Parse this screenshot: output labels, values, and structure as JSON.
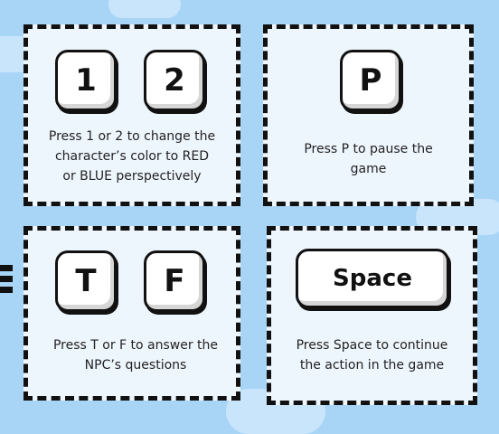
{
  "panels": {
    "color": {
      "keys": [
        "1",
        "2"
      ],
      "lines": [
        "Press 1 or 2 to change the",
        "character’s color to RED",
        "or BLUE perspectively"
      ]
    },
    "pause": {
      "key": "P",
      "lines": [
        "Press P to pause the",
        "game"
      ]
    },
    "answer": {
      "keys": [
        "T",
        "F"
      ],
      "lines": [
        "Press T or F to answer the",
        "NPC’s questions"
      ]
    },
    "continue": {
      "key": "Space",
      "lines": [
        "Press Space to continue",
        "the action in the game"
      ]
    }
  },
  "colors": {
    "sky": "#a8d4f6",
    "panel": "#eef6fd",
    "border": "#111111",
    "key": "#ffffff"
  }
}
